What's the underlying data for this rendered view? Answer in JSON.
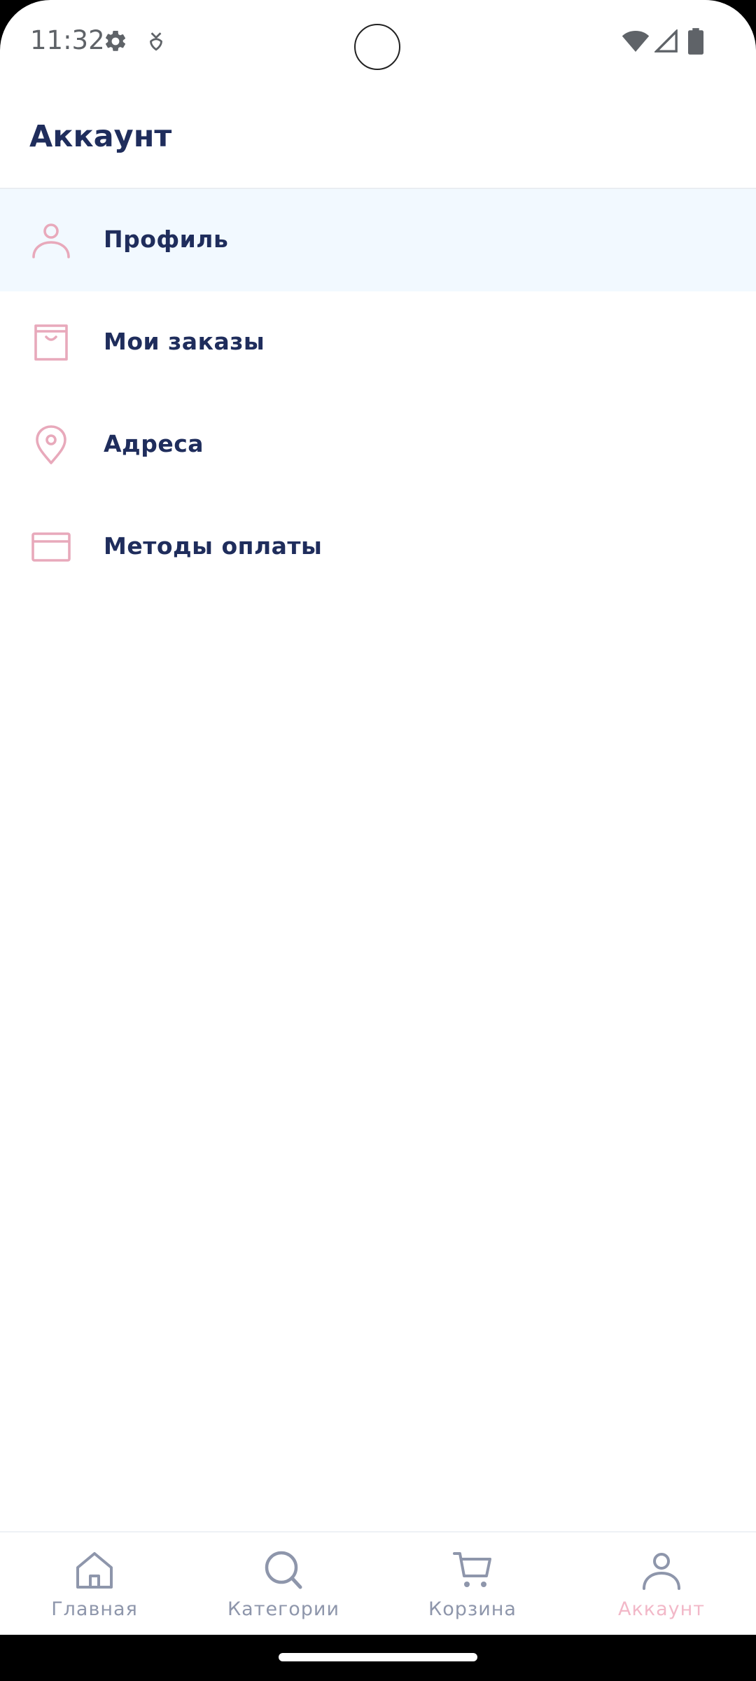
{
  "status_bar": {
    "time": "11:32",
    "icons": [
      "gear-icon",
      "drop-icon",
      "wifi-icon",
      "signal-icon",
      "battery-icon"
    ]
  },
  "header": {
    "title": "Аккаунт"
  },
  "menu": {
    "items": [
      {
        "label": "Профиль",
        "icon": "user-icon",
        "active": true
      },
      {
        "label": "Мои заказы",
        "icon": "bag-icon",
        "active": false
      },
      {
        "label": "Адреса",
        "icon": "location-pin-icon",
        "active": false
      },
      {
        "label": "Методы оплаты",
        "icon": "credit-card-icon",
        "active": false
      }
    ]
  },
  "bottom_nav": {
    "items": [
      {
        "label": "Главная",
        "icon": "home-icon",
        "active": false
      },
      {
        "label": "Категории",
        "icon": "search-icon",
        "active": false
      },
      {
        "label": "Корзина",
        "icon": "cart-icon",
        "active": false
      },
      {
        "label": "Аккаунт",
        "icon": "user-icon",
        "active": true
      }
    ]
  },
  "colors": {
    "title": "#1f2d5c",
    "accent_pink": "#e8a9bb",
    "active_row_bg": "#f2f9ff",
    "nav_inactive": "#8e96ab",
    "nav_active": "#f2b8c8"
  }
}
